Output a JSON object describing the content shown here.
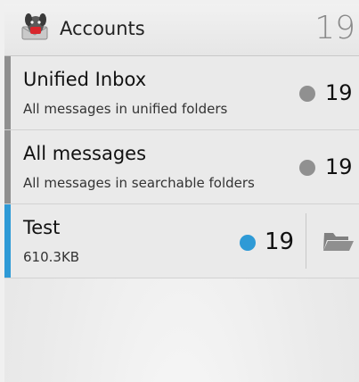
{
  "actionbar": {
    "title": "Accounts",
    "count": "19",
    "app_icon": "k9-mail-dog-icon"
  },
  "accounts": [
    {
      "name": "Unified Inbox",
      "description": "All messages in unified folders",
      "count": "19",
      "stripe_color": "#8f8f8f",
      "dot_color": "#909090"
    },
    {
      "name": "All messages",
      "description": "All messages in searchable folders",
      "count": "19",
      "stripe_color": "#8f8f8f",
      "dot_color": "#909090"
    },
    {
      "name": "Test",
      "description": "610.3KB",
      "count": "19",
      "stripe_color": "#2e9ad6",
      "dot_color": "#2e9ad6",
      "action_icon": "folder-icon"
    }
  ]
}
